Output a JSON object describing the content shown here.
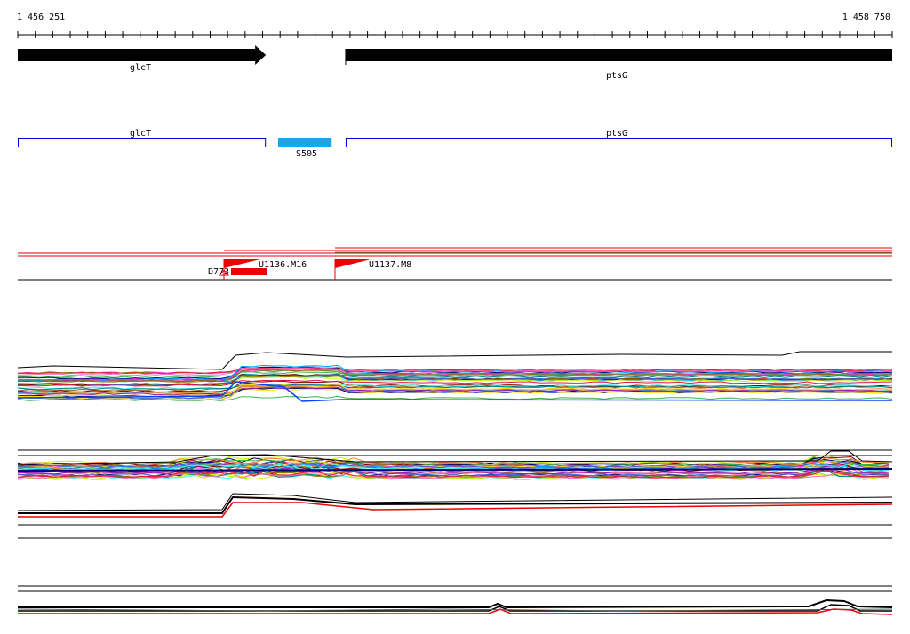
{
  "ruler": {
    "start": "1 456 251",
    "end": "1 458 750",
    "range": [
      1456251,
      1458750
    ]
  },
  "genes": [
    {
      "name": "glcT",
      "start": 1456251,
      "end": 1456960,
      "strand": "+"
    },
    {
      "name": "ptsG",
      "start": 1457188,
      "end": 1458750,
      "strand": "+"
    }
  ],
  "annotations": {
    "gene_boxes": [
      {
        "name": "glcT",
        "start": 1456251,
        "end": 1456960
      },
      {
        "name": "ptsG",
        "start": 1457188,
        "end": 1458750
      }
    ],
    "element": {
      "name": "S505",
      "start": 1456995,
      "end": 1457148
    }
  },
  "segments": [
    {
      "name": "U1136.M16",
      "start": 1456842
    },
    {
      "name": "U1137.M8",
      "start": 1457157
    }
  ],
  "d_label": "D773",
  "colors": {
    "gene_arrow": "#000000",
    "gene_box_border": "#0000cc",
    "element": "#1aa6ee",
    "segment": "#ee0000",
    "profile_palette": [
      "#e6194b",
      "#3cb44b",
      "#ffe119",
      "#4363d8",
      "#f58231",
      "#911eb4",
      "#46f0f0",
      "#f032e6",
      "#bcf60c",
      "#008080",
      "#9a6324",
      "#800000",
      "#808000",
      "#000075",
      "#ff69b4",
      "#00a0ff"
    ]
  }
}
